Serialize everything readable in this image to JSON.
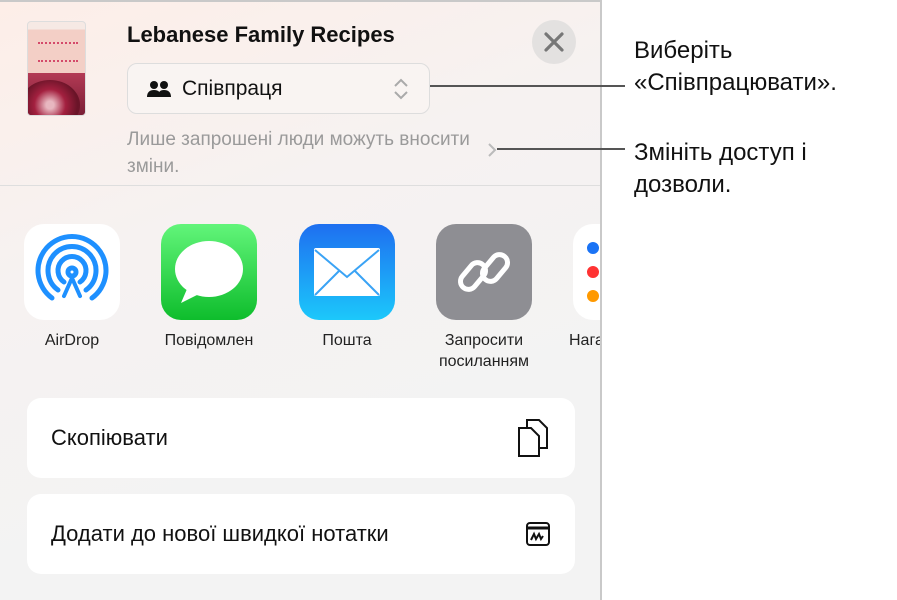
{
  "sheet": {
    "title": "Lebanese Family Recipes",
    "collab_mode": "Співпраця",
    "access_description": "Лише запрошені люди можуть вносити зміни.",
    "apps": [
      {
        "label": "AirDrop",
        "icon": "airdrop-icon"
      },
      {
        "label": "Повідомлен",
        "icon": "messages-icon"
      },
      {
        "label": "Пошта",
        "icon": "mail-icon"
      },
      {
        "label": "Запросити посиланням",
        "icon": "link-icon"
      },
      {
        "label": "Нага",
        "icon": "reminders-icon"
      }
    ],
    "actions": [
      {
        "label": "Скопіювати",
        "icon": "copy-icon"
      },
      {
        "label": "Додати до нової швидкої нотатки",
        "icon": "quick-note-icon"
      }
    ]
  },
  "callouts": {
    "choose": "Виберіть «Співпрацювати».",
    "change_access": "Змініть доступ і дозволи."
  },
  "colors": {
    "messages": "#2fcb4a",
    "mail": "#1a8cf5",
    "link": "#8e8e93",
    "airdrop": "#1e90ff"
  }
}
